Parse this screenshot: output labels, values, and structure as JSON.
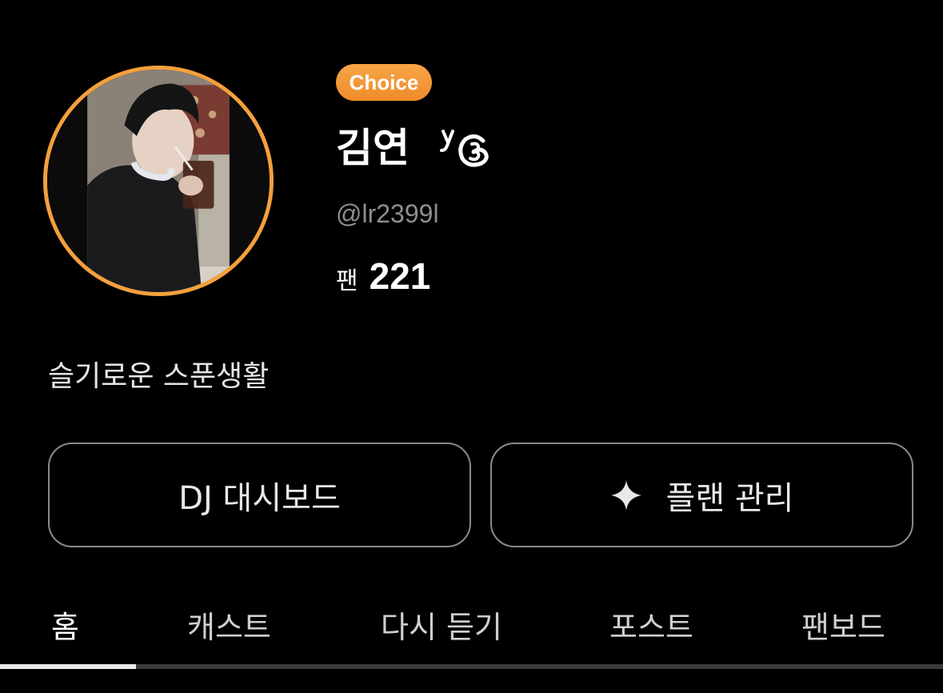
{
  "profile": {
    "badge": "Choice",
    "name": "김연",
    "handle": "@lr2399l",
    "fan_label": "팬",
    "fan_count": "221",
    "bio": "슬기로운 스푼생활",
    "avatar_icon": "profile-photo",
    "level_icon": "level-badge-icon"
  },
  "actions": {
    "dashboard_label": "DJ 대시보드",
    "plan_label": "플랜 관리",
    "plan_icon": "sparkle-icon"
  },
  "tabs": [
    {
      "label": "홈",
      "active": true
    },
    {
      "label": "캐스트",
      "active": false
    },
    {
      "label": "다시 듣기",
      "active": false
    },
    {
      "label": "포스트",
      "active": false
    },
    {
      "label": "팬보드",
      "active": false
    }
  ],
  "colors": {
    "background": "#000000",
    "accent": "#f5a03c",
    "badge": "#ef8c2a",
    "muted_text": "#8e8e8e",
    "button_border": "#8a8a8a",
    "tab_indicator": "#e8e8e8"
  }
}
